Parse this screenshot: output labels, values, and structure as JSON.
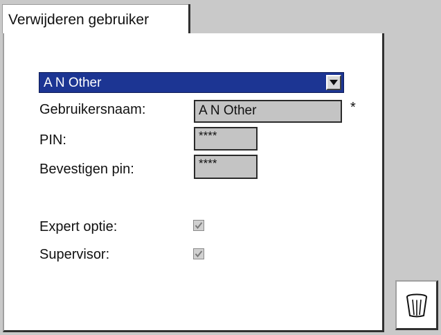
{
  "window": {
    "tab_title": "Verwijderen gebruiker"
  },
  "user_select": {
    "selected": "A N Other",
    "icon": "chevron-down-icon"
  },
  "form": {
    "username_label": "Gebruikersnaam:",
    "username_value": "A N Other",
    "required_marker": "*",
    "pin_label": "PIN:",
    "pin_value": "****",
    "confirm_pin_label": "Bevestigen pin:",
    "confirm_pin_value": "****",
    "expert_label": "Expert optie:",
    "expert_checked": true,
    "supervisor_label": "Supervisor:",
    "supervisor_checked": true
  },
  "actions": {
    "delete_icon": "trash-icon"
  },
  "colors": {
    "selection_bg": "#1c3593",
    "field_bg": "#c4c4c4",
    "background": "#c9c9c9"
  }
}
